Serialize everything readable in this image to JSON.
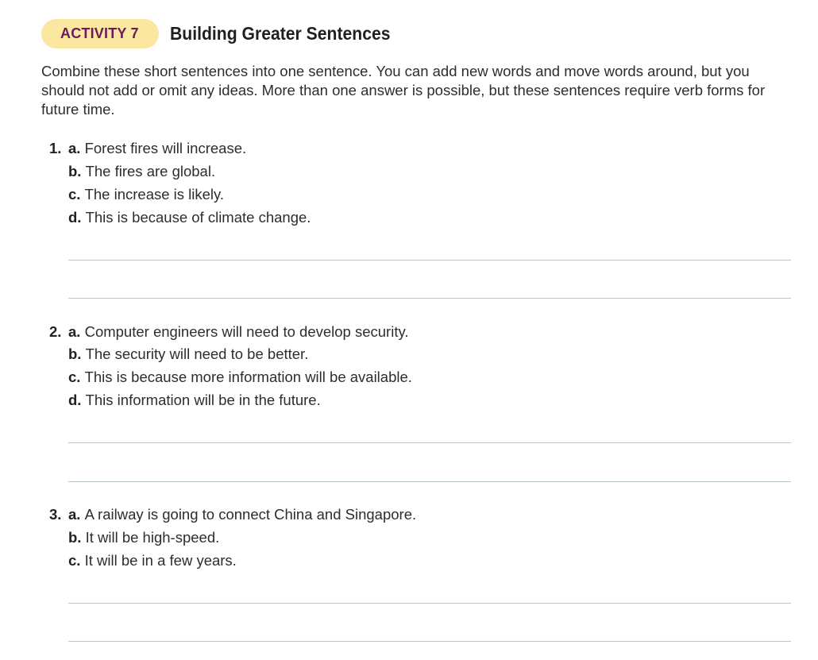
{
  "activity": {
    "badge": "ACTIVITY 7",
    "title": "Building Greater Sentences"
  },
  "instructions": "Combine these short sentences into one sentence. You can add new words and move words around, but you should not add or omit any ideas. More than one answer is possible, but these sentences require verb forms for future time.",
  "exercises": [
    {
      "number": "1.",
      "items": [
        {
          "letter": "a.",
          "text": "Forest fires will increase."
        },
        {
          "letter": "b.",
          "text": "The fires are global."
        },
        {
          "letter": "c.",
          "text": "The increase is likely."
        },
        {
          "letter": "d.",
          "text": "This is because of climate change."
        }
      ]
    },
    {
      "number": "2.",
      "items": [
        {
          "letter": "a.",
          "text": "Computer engineers will need to develop security."
        },
        {
          "letter": "b.",
          "text": "The security will need to be better."
        },
        {
          "letter": "c.",
          "text": "This is because more information will be available."
        },
        {
          "letter": "d.",
          "text": "This information will be in the future."
        }
      ]
    },
    {
      "number": "3.",
      "items": [
        {
          "letter": "a.",
          "text": "A railway is going to connect China and Singapore."
        },
        {
          "letter": "b.",
          "text": "It will be high-speed."
        },
        {
          "letter": "c.",
          "text": "It will be in a few years."
        }
      ]
    }
  ],
  "colors": {
    "badge_background": "#fbe7a0",
    "badge_text": "#6b1a5e",
    "answer_line": "#b9c9c2"
  }
}
